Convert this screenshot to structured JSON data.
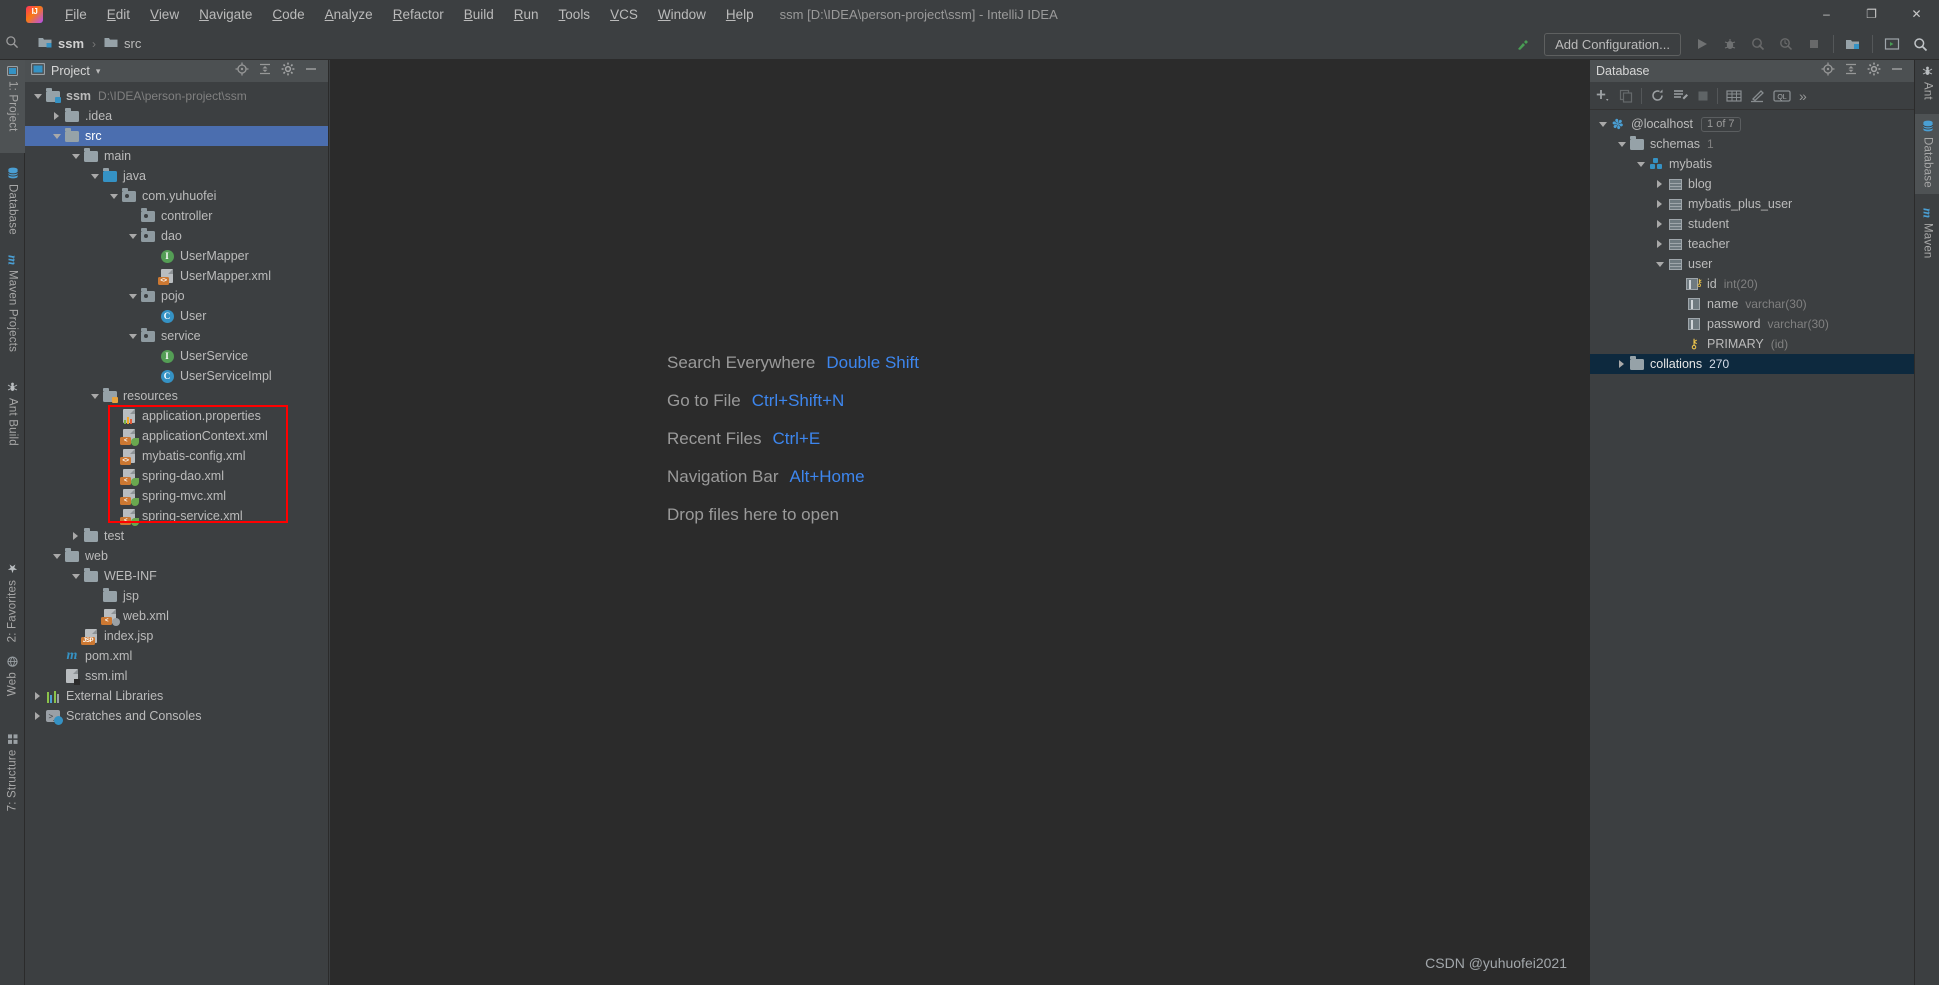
{
  "titlebar": {
    "app_icon": "intellij-logo",
    "menus": [
      "File",
      "Edit",
      "View",
      "Navigate",
      "Code",
      "Analyze",
      "Refactor",
      "Build",
      "Run",
      "Tools",
      "VCS",
      "Window",
      "Help"
    ],
    "window_title": "ssm [D:\\IDEA\\person-project\\ssm] - IntelliJ IDEA",
    "minimize": "–",
    "maximize": "❐",
    "close": "✕"
  },
  "navbar": {
    "breadcrumb": [
      {
        "label": "ssm",
        "icon": "module-folder-icon"
      },
      {
        "label": "src",
        "icon": "folder-icon"
      }
    ],
    "separator": "›",
    "add_configuration_label": "Add Configuration...",
    "buttons": [
      {
        "name": "build-hammer-icon",
        "glyph": "↖"
      },
      {
        "name": "run-icon",
        "glyph": "▶"
      },
      {
        "name": "debug-icon",
        "glyph": "ὁE"
      },
      {
        "name": "run-with-coverage-icon",
        "glyph": "◔"
      },
      {
        "name": "profile-icon",
        "glyph": "◴"
      },
      {
        "name": "stop-icon",
        "glyph": "■"
      },
      {
        "name": "open-project-icon",
        "glyph": "▤"
      },
      {
        "name": "terminal-icon",
        "glyph": "▷"
      },
      {
        "name": "search-everywhere-icon",
        "glyph": "⚲"
      }
    ]
  },
  "left_strip": {
    "top_tabs": [
      {
        "label": "1: Project",
        "icon": "project-icon",
        "selected": true
      },
      {
        "label": "Database",
        "icon": "database-icon",
        "selected": false
      },
      {
        "label": "Maven Projects",
        "icon": "maven-icon",
        "selected": false
      },
      {
        "label": "Ant Build",
        "icon": "ant-icon",
        "selected": false
      }
    ],
    "bottom_tabs": [
      {
        "label": "2: Favorites",
        "icon": "star-icon"
      },
      {
        "label": "Web",
        "icon": "web-icon"
      },
      {
        "label": "7: Structure",
        "icon": "structure-icon"
      }
    ]
  },
  "right_strip": {
    "tabs": [
      {
        "label": "Ant",
        "icon": "ant-icon",
        "selected": false
      },
      {
        "label": "Database",
        "icon": "database-icon",
        "selected": true
      },
      {
        "label": "Maven",
        "icon": "maven-icon",
        "selected": false
      }
    ]
  },
  "project_pane": {
    "title": "Project",
    "dropdown_glyph": "▾",
    "header_icons": [
      {
        "name": "locate-file-icon",
        "glyph": "⊕"
      },
      {
        "name": "collapse-all-icon",
        "glyph": "⨍"
      },
      {
        "name": "settings-gear-icon",
        "glyph": "⚙"
      },
      {
        "name": "hide-icon",
        "glyph": "—"
      }
    ],
    "tree": [
      {
        "label": "ssm",
        "sub": "D:\\IDEA\\person-project\\ssm",
        "icon": "module-folder-icon",
        "indent": 0,
        "twisty": "down",
        "bold": true
      },
      {
        "label": ".idea",
        "icon": "folder-icon",
        "indent": 1,
        "twisty": "right"
      },
      {
        "label": "src",
        "icon": "source-folder-icon",
        "indent": 1,
        "twisty": "down",
        "selected": true
      },
      {
        "label": "main",
        "icon": "folder-icon",
        "indent": 2,
        "twisty": "down"
      },
      {
        "label": "java",
        "icon": "java-source-folder-icon",
        "indent": 3,
        "twisty": "down"
      },
      {
        "label": "com.yuhuofei",
        "icon": "package-icon",
        "indent": 4,
        "twisty": "down"
      },
      {
        "label": "controller",
        "icon": "package-icon",
        "indent": 5,
        "twisty": "none"
      },
      {
        "label": "dao",
        "icon": "package-icon",
        "indent": 5,
        "twisty": "down"
      },
      {
        "label": "UserMapper",
        "icon": "interface-icon",
        "indent": 6,
        "twisty": "none"
      },
      {
        "label": "UserMapper.xml",
        "icon": "xml-file-icon",
        "indent": 6,
        "twisty": "none"
      },
      {
        "label": "pojo",
        "icon": "package-icon",
        "indent": 5,
        "twisty": "down"
      },
      {
        "label": "User",
        "icon": "class-icon",
        "indent": 6,
        "twisty": "none"
      },
      {
        "label": "service",
        "icon": "package-icon",
        "indent": 5,
        "twisty": "down"
      },
      {
        "label": "UserService",
        "icon": "interface-icon",
        "indent": 6,
        "twisty": "none"
      },
      {
        "label": "UserServiceImpl",
        "icon": "class-icon",
        "indent": 6,
        "twisty": "none"
      },
      {
        "label": "resources",
        "icon": "resource-folder-icon",
        "indent": 3,
        "twisty": "down"
      },
      {
        "label": "application.properties",
        "icon": "properties-file-icon",
        "indent": 4,
        "twisty": "none",
        "highlighted": true
      },
      {
        "label": "applicationContext.xml",
        "icon": "spring-xml-file-icon",
        "indent": 4,
        "twisty": "none",
        "highlighted": true
      },
      {
        "label": "mybatis-config.xml",
        "icon": "xml-file-icon",
        "indent": 4,
        "twisty": "none",
        "highlighted": true
      },
      {
        "label": "spring-dao.xml",
        "icon": "spring-xml-file-icon",
        "indent": 4,
        "twisty": "none",
        "highlighted": true
      },
      {
        "label": "spring-mvc.xml",
        "icon": "spring-xml-file-icon",
        "indent": 4,
        "twisty": "none",
        "highlighted": true
      },
      {
        "label": "spring-service.xml",
        "icon": "spring-xml-file-icon",
        "indent": 4,
        "twisty": "none",
        "highlighted": true
      },
      {
        "label": "test",
        "icon": "folder-icon",
        "indent": 2,
        "twisty": "right"
      },
      {
        "label": "web",
        "icon": "folder-icon",
        "indent": 1,
        "twisty": "down"
      },
      {
        "label": "WEB-INF",
        "icon": "folder-icon",
        "indent": 2,
        "twisty": "down"
      },
      {
        "label": "jsp",
        "icon": "folder-icon",
        "indent": 3,
        "twisty": "none"
      },
      {
        "label": "web.xml",
        "icon": "web-xml-file-icon",
        "indent": 3,
        "twisty": "none"
      },
      {
        "label": "index.jsp",
        "icon": "jsp-file-icon",
        "indent": 2,
        "twisty": "none"
      },
      {
        "label": "pom.xml",
        "icon": "maven-pom-icon",
        "indent": 1,
        "twisty": "none"
      },
      {
        "label": "ssm.iml",
        "icon": "iml-file-icon",
        "indent": 1,
        "twisty": "none"
      },
      {
        "label": "External Libraries",
        "icon": "libraries-icon",
        "indent": 0,
        "twisty": "right"
      },
      {
        "label": "Scratches and Consoles",
        "icon": "scratches-icon",
        "indent": 0,
        "twisty": "right"
      }
    ],
    "highlight_box_color": "#ff0000"
  },
  "editor": {
    "welcome_rows": [
      {
        "label": "Search Everywhere",
        "shortcut": "Double Shift"
      },
      {
        "label": "Go to File",
        "shortcut": "Ctrl+Shift+N"
      },
      {
        "label": "Recent Files",
        "shortcut": "Ctrl+E"
      },
      {
        "label": "Navigation Bar",
        "shortcut": "Alt+Home"
      },
      {
        "label": "Drop files here to open",
        "shortcut": ""
      }
    ],
    "watermark": "CSDN @yuhuofei2021",
    "shortcut_color": "#3d86ee",
    "label_color": "#9a9a9a"
  },
  "database_pane": {
    "title": "Database",
    "header_icons": [
      {
        "name": "locate-icon",
        "glyph": "⊕"
      },
      {
        "name": "collapse-all-icon",
        "glyph": "⨍"
      },
      {
        "name": "settings-gear-icon",
        "glyph": "⚙"
      },
      {
        "name": "hide-icon",
        "glyph": "—"
      }
    ],
    "toolbar_icons": [
      {
        "name": "add-data-source-icon",
        "glyph": "+"
      },
      {
        "name": "duplicate-icon",
        "glyph": "⧉"
      },
      {
        "name": "refresh-icon",
        "glyph": "⟳"
      },
      {
        "name": "data-source-properties-icon",
        "glyph": "⚒"
      },
      {
        "name": "stop-icon",
        "glyph": "■"
      },
      {
        "name": "open-table-editor-icon",
        "glyph": "▦"
      },
      {
        "name": "modify-table-icon",
        "glyph": "✎"
      },
      {
        "name": "open-query-console-icon",
        "glyph": "QL"
      },
      {
        "name": "more-icon",
        "glyph": "»"
      }
    ],
    "tree": [
      {
        "label": "@localhost",
        "pill": "1 of 7",
        "icon": "mysql-dolphin-icon",
        "indent": 0,
        "twisty": "down"
      },
      {
        "label": "schemas",
        "sub": "1",
        "icon": "folder-icon",
        "indent": 1,
        "twisty": "down"
      },
      {
        "label": "mybatis",
        "icon": "schema-icon",
        "indent": 2,
        "twisty": "down"
      },
      {
        "label": "blog",
        "icon": "table-icon",
        "indent": 3,
        "twisty": "right"
      },
      {
        "label": "mybatis_plus_user",
        "icon": "table-icon",
        "indent": 3,
        "twisty": "right"
      },
      {
        "label": "student",
        "icon": "table-icon",
        "indent": 3,
        "twisty": "right"
      },
      {
        "label": "teacher",
        "icon": "table-icon",
        "indent": 3,
        "twisty": "right"
      },
      {
        "label": "user",
        "icon": "table-icon",
        "indent": 3,
        "twisty": "down"
      },
      {
        "label": "id",
        "sub": "int(20)",
        "icon": "primary-key-column-icon",
        "indent": 4,
        "twisty": "none"
      },
      {
        "label": "name",
        "sub": "varchar(30)",
        "icon": "column-icon",
        "indent": 4,
        "twisty": "none"
      },
      {
        "label": "password",
        "sub": "varchar(30)",
        "icon": "column-icon",
        "indent": 4,
        "twisty": "none"
      },
      {
        "label": "PRIMARY",
        "sub": "(id)",
        "icon": "key-icon",
        "indent": 4,
        "twisty": "none"
      },
      {
        "label": "collations",
        "sub": "270",
        "icon": "folder-icon",
        "indent": 1,
        "twisty": "right",
        "selected": true
      }
    ]
  }
}
